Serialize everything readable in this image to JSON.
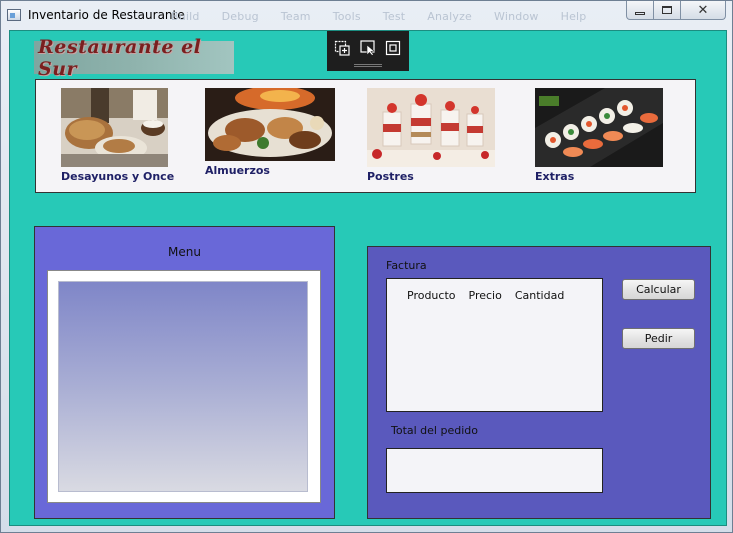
{
  "window": {
    "title": "Inventario de Restaurante",
    "ghost_menu": [
      "Build",
      "Debug",
      "Team",
      "Tools",
      "Test",
      "Analyze",
      "Window",
      "Help"
    ],
    "controls": {
      "minimize": "",
      "maximize": "",
      "close": "✕"
    }
  },
  "logo": {
    "text": "Restaurante el Sur"
  },
  "categories": [
    {
      "label": "Desayunos y Once",
      "icon": "breakfast-photo"
    },
    {
      "label": "Almuerzos",
      "icon": "lunch-photo"
    },
    {
      "label": "Postres",
      "icon": "desserts-photo"
    },
    {
      "label": "Extras",
      "icon": "sushi-photo"
    }
  ],
  "menu": {
    "title": "Menu"
  },
  "invoice": {
    "title": "Factura",
    "columns": [
      "Producto",
      "Precio",
      "Cantidad"
    ],
    "total_label": "Total del pedido",
    "calculate_label": "Calcular",
    "order_label": "Pedir"
  },
  "colors": {
    "background": "#27c9b7",
    "menu_panel": "#6968d8",
    "invoice_panel": "#5a59bd",
    "category_label": "#1f2066"
  }
}
